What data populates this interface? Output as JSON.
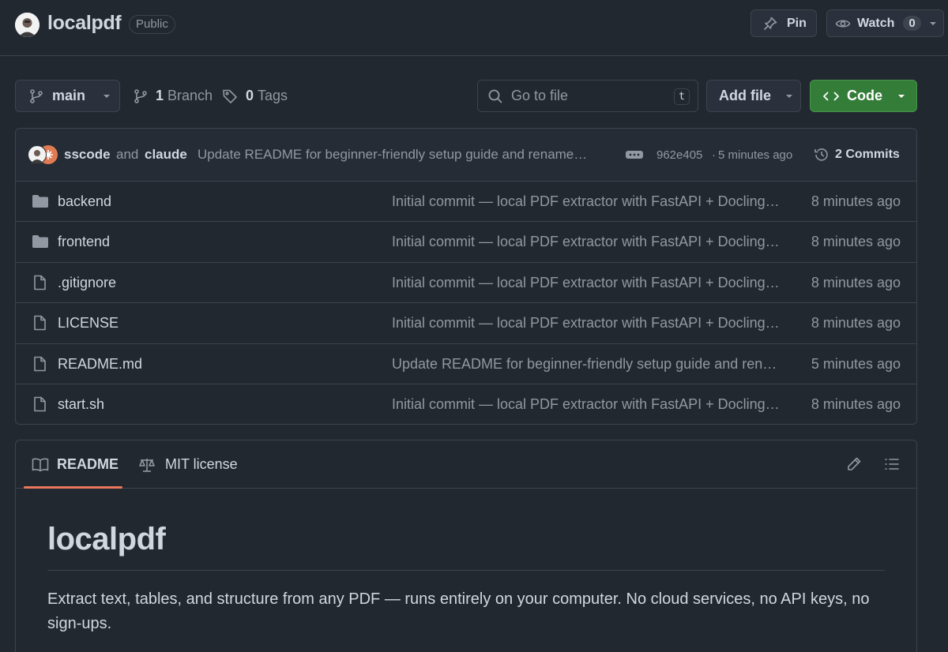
{
  "repo": {
    "name": "localpdf",
    "visibility": "Public",
    "pin_label": "Pin",
    "watch_label": "Watch",
    "watch_count": "0"
  },
  "toolbar": {
    "branch": "main",
    "branches_count": "1",
    "branches_label": "Branch",
    "tags_count": "0",
    "tags_label": "Tags",
    "search_placeholder": "Go to file",
    "search_shortcut": "t",
    "add_file_label": "Add file",
    "code_label": "Code"
  },
  "latest_commit": {
    "author1": "sscode",
    "joiner": "and",
    "author2": "claude",
    "message": "Update README for beginner-friendly setup guide and rename…",
    "hash": "962e405",
    "separator": "·",
    "time": "5 minutes ago",
    "commits_label": "2 Commits"
  },
  "files": [
    {
      "name": "backend",
      "type": "folder",
      "message": "Initial commit — local PDF extractor with FastAPI + Docling…",
      "time": "8 minutes ago"
    },
    {
      "name": "frontend",
      "type": "folder",
      "message": "Initial commit — local PDF extractor with FastAPI + Docling…",
      "time": "8 minutes ago"
    },
    {
      "name": ".gitignore",
      "type": "file",
      "message": "Initial commit — local PDF extractor with FastAPI + Docling…",
      "time": "8 minutes ago"
    },
    {
      "name": "LICENSE",
      "type": "file",
      "message": "Initial commit — local PDF extractor with FastAPI + Docling…",
      "time": "8 minutes ago"
    },
    {
      "name": "README.md",
      "type": "file",
      "message": "Update README for beginner-friendly setup guide and ren…",
      "time": "5 minutes ago"
    },
    {
      "name": "start.sh",
      "type": "file",
      "message": "Initial commit — local PDF extractor with FastAPI + Docling…",
      "time": "8 minutes ago"
    }
  ],
  "readme": {
    "tab_readme": "README",
    "tab_license": "MIT license",
    "title": "localpdf",
    "description": "Extract text, tables, and structure from any PDF — runs entirely on your computer. No cloud services, no API keys, no sign-ups."
  },
  "colors": {
    "background": "#212830",
    "code_button": "#347d39",
    "active_tab_underline": "#ec775c"
  }
}
